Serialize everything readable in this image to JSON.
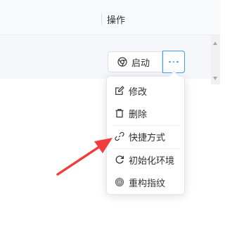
{
  "table": {
    "header_label": "操作"
  },
  "row_actions": {
    "start_label": "启动",
    "start_icon": "chrome-icon",
    "more_icon": "more-dots-icon",
    "accent_color": "#409eff"
  },
  "dropdown": {
    "items": [
      {
        "label": "修改",
        "icon": "edit-icon"
      },
      {
        "label": "删除",
        "icon": "trash-icon"
      },
      {
        "label": "快捷方式",
        "icon": "link-icon"
      },
      {
        "label": "初始化环境",
        "icon": "reset-icon"
      },
      {
        "label": "重构指纹",
        "icon": "fingerprint-icon"
      }
    ]
  },
  "annotation": {
    "arrow_color": "#f33b3b",
    "points_to": "快捷方式"
  }
}
